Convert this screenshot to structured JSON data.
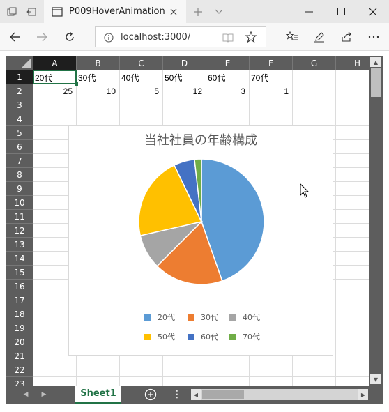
{
  "browser": {
    "tab_title": "P009HoverAnimation",
    "url": "localhost:3000/"
  },
  "sheet": {
    "columns": [
      "A",
      "B",
      "C",
      "D",
      "E",
      "F",
      "G",
      "H"
    ],
    "rows": [
      "1",
      "2",
      "3",
      "4",
      "5",
      "6",
      "7",
      "8",
      "9",
      "10",
      "11",
      "12",
      "13",
      "14",
      "15",
      "16",
      "17",
      "18",
      "19",
      "20",
      "21",
      "22",
      "23"
    ],
    "row1": [
      "20代",
      "30代",
      "40代",
      "50代",
      "60代",
      "70代"
    ],
    "row2": [
      "25",
      "10",
      "5",
      "12",
      "3",
      "1"
    ],
    "tab_name": "Sheet1",
    "selected_cell": "A1"
  },
  "chart_data": {
    "type": "pie",
    "title": "当社社員の年齢構成",
    "categories": [
      "20代",
      "30代",
      "40代",
      "50代",
      "60代",
      "70代"
    ],
    "values": [
      25,
      10,
      5,
      12,
      3,
      1
    ],
    "colors": [
      "#5b9bd5",
      "#ed7d31",
      "#a5a5a5",
      "#ffc000",
      "#4472c4",
      "#70ad47"
    ],
    "legend": "bottom"
  }
}
